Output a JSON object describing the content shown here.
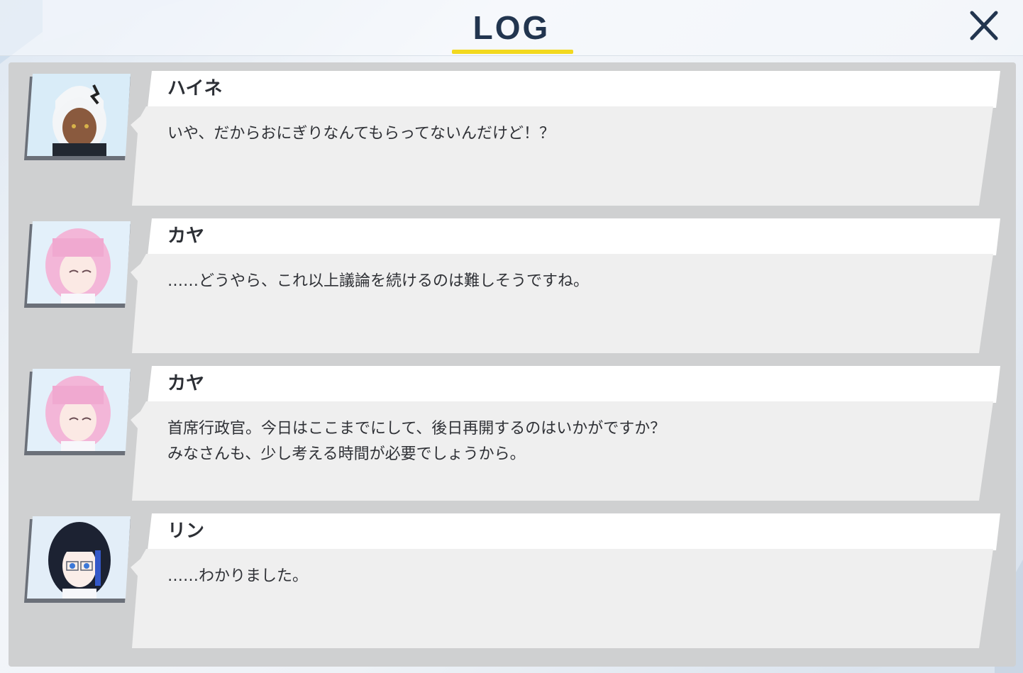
{
  "header": {
    "title": "LOG"
  },
  "entries": [
    {
      "speaker": "ハイネ",
      "lines": [
        "いや、だからおにぎりなんてもらってないんだけど！？"
      ],
      "avatar_icon": "portrait-white-hair-icon"
    },
    {
      "speaker": "カヤ",
      "lines": [
        "……どうやら、これ以上議論を続けるのは難しそうですね。"
      ],
      "avatar_icon": "portrait-pink-hair-icon"
    },
    {
      "speaker": "カヤ",
      "lines": [
        "首席行政官。今日はここまでにして、後日再開するのはいかがですか？",
        "みなさんも、少し考える時間が必要でしょうから。"
      ],
      "avatar_icon": "portrait-pink-hair-icon"
    },
    {
      "speaker": "リン",
      "lines": [
        "……わかりました。"
      ],
      "avatar_icon": "portrait-black-hair-icon"
    }
  ],
  "colors": {
    "title": "#22354f",
    "accent": "#f2d91f",
    "panel": "#cfd0d1",
    "bubble": "#f0f0f0",
    "name_box": "#ffffff"
  }
}
